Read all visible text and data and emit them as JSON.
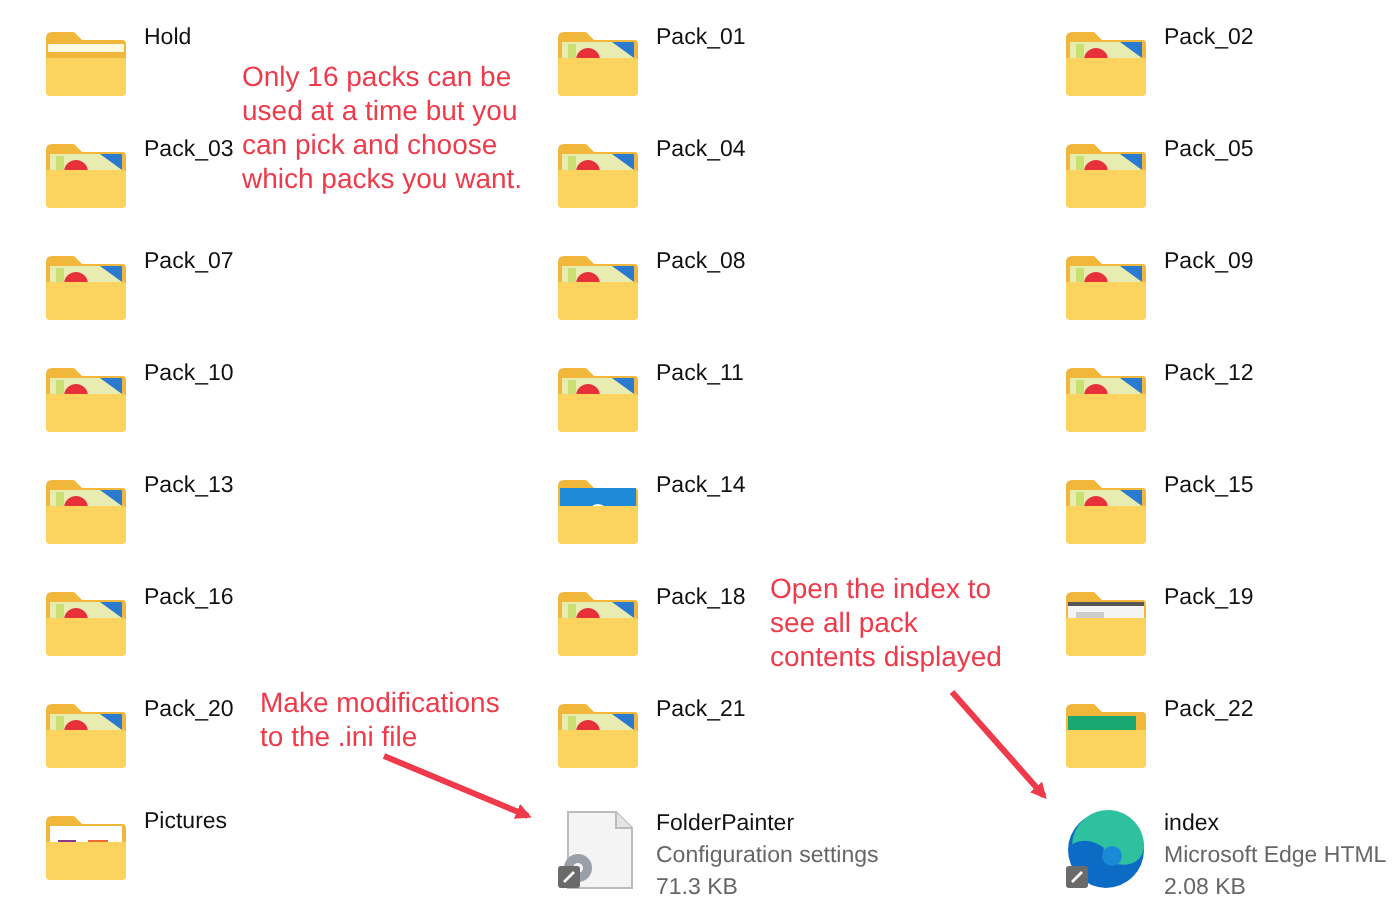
{
  "items": [
    {
      "kind": "folder",
      "name": "Hold"
    },
    {
      "kind": "pack",
      "name": "Pack_01"
    },
    {
      "kind": "pack",
      "name": "Pack_02"
    },
    {
      "kind": "pack",
      "name": "Pack_03"
    },
    {
      "kind": "pack",
      "name": "Pack_04"
    },
    {
      "kind": "pack",
      "name": "Pack_05"
    },
    {
      "kind": "pack",
      "name": "Pack_07"
    },
    {
      "kind": "pack",
      "name": "Pack_08"
    },
    {
      "kind": "pack",
      "name": "Pack_09"
    },
    {
      "kind": "pack",
      "name": "Pack_10"
    },
    {
      "kind": "pack",
      "name": "Pack_11"
    },
    {
      "kind": "pack",
      "name": "Pack_12"
    },
    {
      "kind": "pack",
      "name": "Pack_13"
    },
    {
      "kind": "blue",
      "name": "Pack_14"
    },
    {
      "kind": "pack",
      "name": "Pack_15"
    },
    {
      "kind": "pack",
      "name": "Pack_16"
    },
    {
      "kind": "pack",
      "name": "Pack_18"
    },
    {
      "kind": "document",
      "name": "Pack_19"
    },
    {
      "kind": "pack",
      "name": "Pack_20"
    },
    {
      "kind": "pack",
      "name": "Pack_21"
    },
    {
      "kind": "green",
      "name": "Pack_22"
    },
    {
      "kind": "pictures",
      "name": "Pictures"
    },
    {
      "kind": "config",
      "name": "FolderPainter",
      "type": "Configuration settings",
      "size": "71.3 KB"
    },
    {
      "kind": "edge",
      "name": "index",
      "type": "Microsoft Edge HTML",
      "size": "2.08 KB"
    }
  ],
  "annotations": [
    {
      "kind": "packs",
      "text": "Only 16 packs can be used at a time but you can pick and choose which packs you want."
    },
    {
      "kind": "index",
      "text": "Open the index to see all pack contents displayed"
    },
    {
      "kind": "ini",
      "text": "Make modifications to the .ini file"
    }
  ]
}
